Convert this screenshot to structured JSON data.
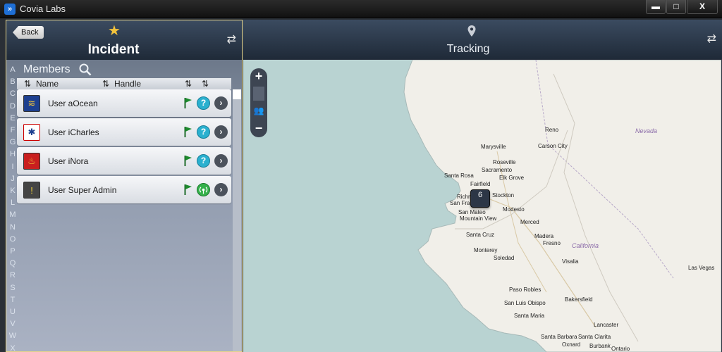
{
  "window": {
    "title": "Covia Labs",
    "icon_glyph": "»",
    "controls": {
      "minimize": "▬",
      "maximize": "□",
      "close": "X"
    }
  },
  "left": {
    "back_label": "Back",
    "title": "Incident",
    "members_label": "Members",
    "columns": {
      "name": "Name",
      "handle": "Handle"
    },
    "alphabet": [
      "A",
      "B",
      "C",
      "D",
      "E",
      "F",
      "G",
      "H",
      "I",
      "J",
      "K",
      "L",
      "M",
      "N",
      "O",
      "P",
      "Q",
      "R",
      "S",
      "T",
      "U",
      "V",
      "W",
      "X"
    ],
    "members": [
      {
        "name": "User aOcean",
        "avatar": "sergeant-chevron-icon",
        "avatar_color": "#1d3f8f",
        "status": "help"
      },
      {
        "name": "User iCharles",
        "avatar": "star-of-life-icon",
        "avatar_color": "#ffffff",
        "status": "help"
      },
      {
        "name": "User iNora",
        "avatar": "firefighter-icon",
        "avatar_color": "#c91f1f",
        "status": "help"
      },
      {
        "name": "User Super Admin",
        "avatar": "alert-shield-icon",
        "avatar_color": "#444444",
        "status": "signal"
      }
    ]
  },
  "right": {
    "title": "Tracking",
    "zoom": {
      "in": "+",
      "out": "−"
    },
    "cluster_count": "6",
    "places": [
      "Reno",
      "Carson City",
      "Marysville",
      "Roseville",
      "Sacramento",
      "Elk Grove",
      "Santa Rosa",
      "Fairfield",
      "Stockton",
      "Richmond",
      "San Francisco",
      "San Mateo",
      "Mountain View",
      "Modesto",
      "Merced",
      "Santa Cruz",
      "Madera",
      "Fresno",
      "Monterey",
      "Soledad",
      "Visalia",
      "Paso Robles",
      "San Luis Obispo",
      "Bakersfield",
      "Santa Maria",
      "Lancaster",
      "Santa Barbara",
      "Santa Clarita",
      "Oxnard",
      "Burbank",
      "Ontario",
      "Las Vegas"
    ],
    "states": [
      "Nevada",
      "California"
    ]
  },
  "colors": {
    "accent": "#e6d48a",
    "water": "#b9d3d2",
    "land": "#f1efe9",
    "flag": "#1e8b2e",
    "help": "#2ab0cf"
  }
}
